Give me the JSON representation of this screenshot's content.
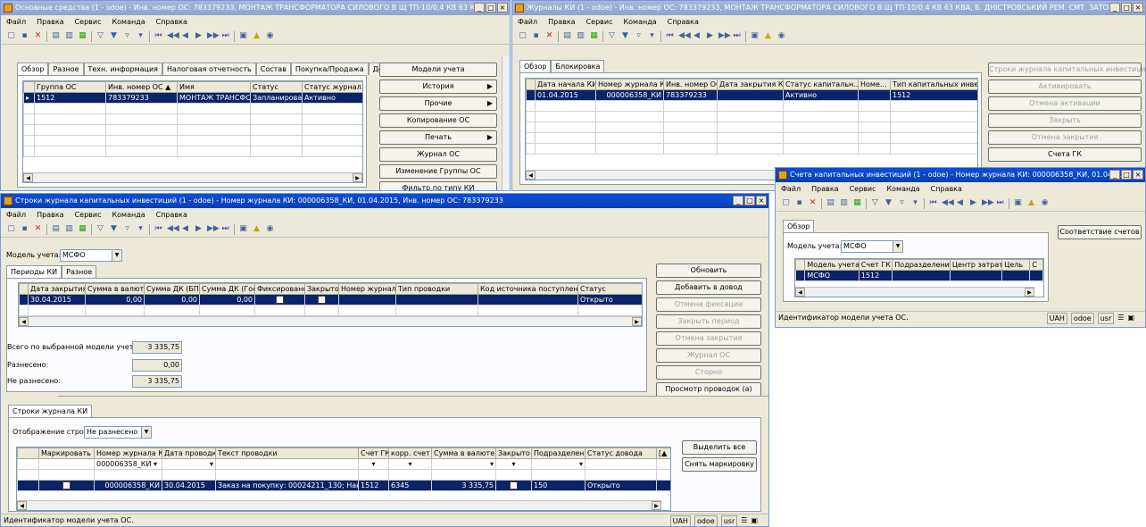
{
  "w1": {
    "title": "Основные средства (1 - odoe) - Инв. номер ОС: 783379233, МОНТАЖ ТРАНСФОРМАТОРА СИЛОВОГО В Щ ТП-10/0,4 КВ 63 КВ...",
    "tabs": [
      "Обзор",
      "Разное",
      "Техн. информация",
      "Налоговая отчетность",
      "Состав",
      "Покупка/Продажа",
      "Документы"
    ],
    "cols": [
      "Группа ОС",
      "Инв. номер ОС",
      "Имя",
      "Статус",
      "Статус журнал."
    ],
    "row": [
      "1512",
      "783379233",
      "МОНТАЖ ТРАНСФО...",
      "Запланировано",
      "Активно"
    ],
    "buttons": [
      "Модели учета",
      "История",
      "Прочие",
      "Копирование ОС",
      "Печать",
      "Журнал ОС",
      "Изменение Группы ОС",
      "Фильтр по типу КИ"
    ]
  },
  "w2": {
    "title": "Журналы КИ (1 - odoe) - Инв. номер ОС: 783379233, МОНТАЖ ТРАНСФОРМАТОРА СИЛОВОГО В Щ ТП-10/0,4 КВ 63 КВА, Б. ДНІСТРОВСЬКИЙ РЕМ. СМТ. ЗАТОКА СТ \"Б...",
    "tabs": [
      "Обзор",
      "Блокировка"
    ],
    "cols": [
      "Дата начала КИ",
      "Номер журнала КИ",
      "Инв. номер ОС",
      "Дата закрытия КИ",
      "Статус капитальн...",
      "Номе...",
      "Тип капитальных инве"
    ],
    "row": [
      "01.04.2015",
      "000006358_КИ",
      "783379233",
      "",
      "Активно",
      "",
      "1512"
    ],
    "buttons": [
      "Строки журнала капитальных инвестиций",
      "Активировать",
      "Отмена активации",
      "Закрыть",
      "Отмена закрытия",
      "Счета ГК"
    ]
  },
  "w3": {
    "title": "Строки журнала капитальных инвестиций (1 - odoe) - Номер журнала КИ: 000006358_КИ, 01.04.2015, Инв. номер ОС: 783379233",
    "model_label": "Модель учета:",
    "model_value": "МСФО",
    "tabs": [
      "Периоды КИ",
      "Разное"
    ],
    "cols": [
      "Дата закрытия",
      "Сумма в валюте",
      "Сумма ДК (БП)",
      "Сумма ДК (Гос.)",
      "Фиксировано",
      "Закрыто",
      "Номер журнала",
      "Тип проводки",
      "Код источника поступления",
      "Статус"
    ],
    "row": [
      "30.04.2015",
      "0,00",
      "0,00",
      "0,00",
      "",
      "",
      "",
      "",
      "",
      "Открыто"
    ],
    "total_label": "Всего по выбранной модели учета:",
    "total_value": "3 335,75",
    "placed_label": "Разнесено:",
    "placed_value": "0,00",
    "notplaced_label": "Не разнесено:",
    "notplaced_value": "3 335,75",
    "buttons": [
      "Обновить",
      "Добавить в довод",
      "Отмена фиксации",
      "Закрыть период",
      "Отмена закрытия",
      "Журнал ОС",
      "Сторно",
      "Просмотр проводок (а)"
    ],
    "lower_tab": "Строки журнала КИ",
    "display_label": "Отображение строк:",
    "display_value": "Не разнесено",
    "cols2": [
      "Маркировать",
      "Номер журнала КИ",
      "Дата проводки",
      "Текст проводки",
      "Счет ГК",
      "корр. счет",
      "Сумма в валюте",
      "Закрыто",
      "Подразделение",
      "Статус довода"
    ],
    "filter_value": "000006358_КИ",
    "row2": [
      "",
      "000006358_КИ",
      "30.04.2015",
      "Заказ на покупку: 00024211_130; Накл...",
      "1512",
      "6345",
      "3 335,75",
      "",
      "150",
      "Открыто"
    ],
    "buttons2": [
      "Выделить все",
      "Снять маркировку"
    ],
    "status": "Идентификатор модели учета ОС.",
    "status_right": [
      "UAH",
      "odoe",
      "usr"
    ]
  },
  "w4": {
    "title": "Счета капитальных инвестиций (1 - odoe) - Номер журнала КИ: 000006358_КИ, 01.04.2...",
    "tab": "Обзор",
    "model_label": "Модель учета:",
    "model_value": "МСФО",
    "cols": [
      "Модель учета",
      "Счет ГК",
      "Подразделение",
      "Центр затрат",
      "Цель",
      "С"
    ],
    "row": [
      "МСФО",
      "1512",
      "",
      "",
      "",
      ""
    ],
    "button": "Соответствие счетов",
    "status": "Идентификатор модели учета ОС.",
    "status_right": [
      "UAH",
      "odoe",
      "usr"
    ]
  },
  "menu": [
    "Файл",
    "Правка",
    "Сервис",
    "Команда",
    "Справка"
  ]
}
